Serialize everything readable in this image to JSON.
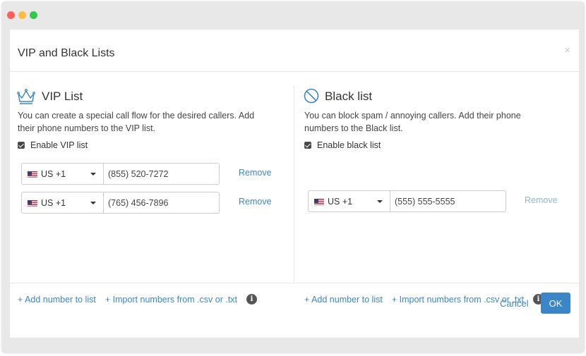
{
  "window": {
    "controls": [
      "close",
      "minimize",
      "maximize"
    ]
  },
  "modal": {
    "title": "VIP and Black Lists",
    "close_label": "×"
  },
  "vip": {
    "title": "VIP List",
    "icon": "crown-icon",
    "description_line1": "You can create a special call flow for the desired callers. Add",
    "description_line2": "their phone numbers to the VIP list.",
    "enable_label": "Enable VIP list",
    "enabled": true,
    "entries": [
      {
        "country": "US +1",
        "number": "(855) 520-7272",
        "remove_label": "Remove"
      },
      {
        "country": "US +1",
        "number": "(765) 456-7896",
        "remove_label": "Remove"
      }
    ],
    "add_label": "+ Add number to list",
    "import_label": "+ Import numbers from .csv or .txt"
  },
  "black": {
    "title": "Black list",
    "icon": "block-icon",
    "description_line1": "You can block spam / annoying callers. Add their phone",
    "description_line2": "numbers to the Black list.",
    "enable_label": "Enable black list",
    "enabled": true,
    "entries": [
      {
        "country": "US +1",
        "number": "(555) 555-5555",
        "remove_label": "Remove"
      }
    ],
    "add_label": "+ Add number to list",
    "import_label": "+ Import numbers from .csv or .txt"
  },
  "footer": {
    "cancel_label": "Cancel",
    "ok_label": "OK"
  },
  "colors": {
    "accent": "#3b86c8",
    "divider": "#e5e5e5",
    "window_bg": "#e8e8e8"
  }
}
